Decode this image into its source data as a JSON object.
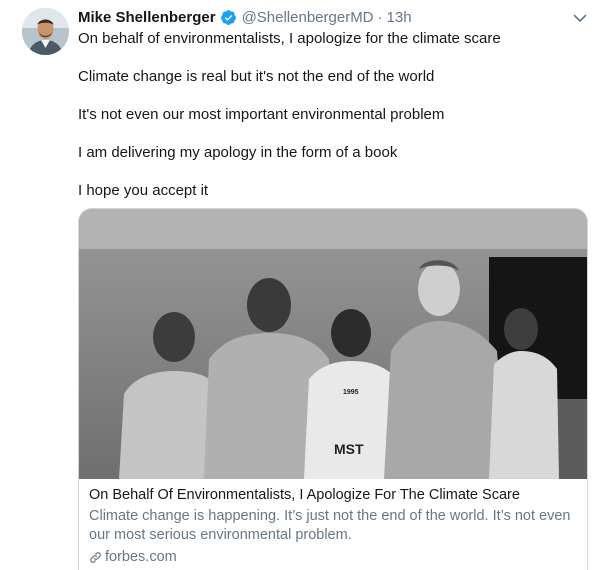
{
  "author": {
    "name": "Mike Shellenberger",
    "handle": "@ShellenbergerMD",
    "separator": "·",
    "time": "13h",
    "verified": true,
    "avatar_icon": "profile-photo"
  },
  "tweet": {
    "lines": [
      "On behalf of environmentalists, I apologize for the climate scare",
      "Climate change is real but it's not the end of the world",
      "It's not even our most important environmental problem",
      "I am delivering my apology in the form of a book",
      "I hope you accept it"
    ]
  },
  "card": {
    "image_desc_icon": "photo-five-men",
    "shirt_text": [
      "1995",
      "MST"
    ],
    "title": "On Behalf Of Environmentalists, I Apologize For The Climate Scare",
    "description": "Climate change is happening. It’s just not the end of the world. It’s not even our most serious environmental problem.",
    "domain": "forbes.com"
  },
  "colors": {
    "text": "#14171a",
    "secondary": "#657786",
    "border": "#ccd6dd",
    "verified": "#1da1f2"
  }
}
